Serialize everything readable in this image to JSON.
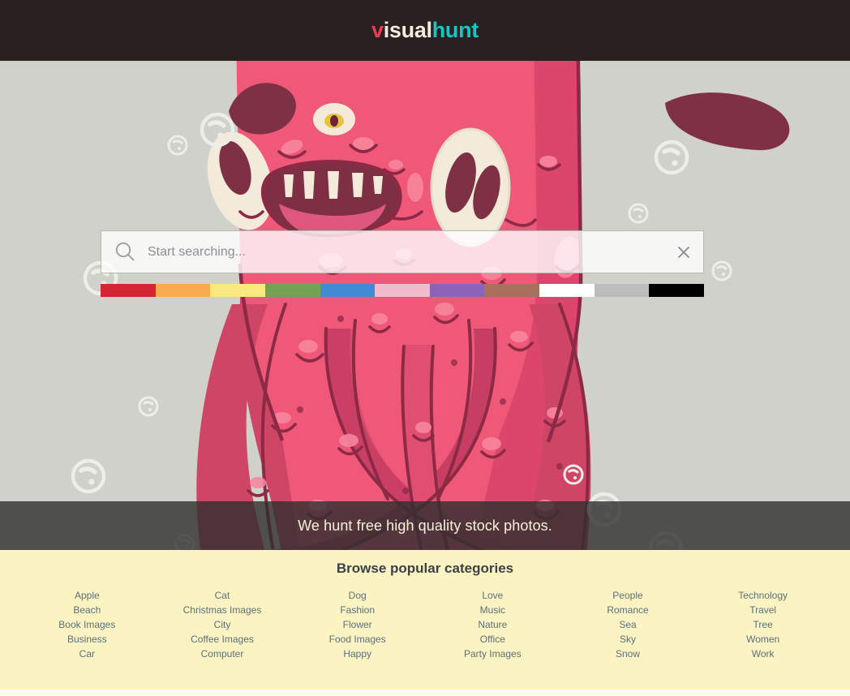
{
  "header": {
    "logo": {
      "part1": "v",
      "part2": "isual",
      "part3": "hunt"
    },
    "bg_color": "#292120",
    "logo_colors": {
      "v": "#f0385a",
      "isual": "#f3eddd",
      "hunt": "#18c4c4"
    }
  },
  "hero": {
    "bg_color": "#d0d1cb",
    "illustration": "pink-monster-illustration",
    "search": {
      "icon": "search-icon",
      "placeholder": "Start searching...",
      "value": "",
      "clear_icon": "close-icon"
    },
    "color_filters": [
      {
        "name": "red",
        "hex": "#d32534"
      },
      {
        "name": "orange",
        "hex": "#f9ac4e"
      },
      {
        "name": "yellow",
        "hex": "#f8ea7f"
      },
      {
        "name": "green",
        "hex": "#73a252"
      },
      {
        "name": "blue",
        "hex": "#428bd4"
      },
      {
        "name": "pink",
        "hex": "#f0bbcc"
      },
      {
        "name": "purple",
        "hex": "#8b63b8"
      },
      {
        "name": "brown",
        "hex": "#a9705e"
      },
      {
        "name": "white",
        "hex": "#ffffff"
      },
      {
        "name": "gray",
        "hex": "#bcbcbc"
      },
      {
        "name": "black",
        "hex": "#000000"
      }
    ],
    "tagline": "We hunt free high quality stock photos.",
    "tagline_bar_color": "#2e2e2e"
  },
  "categories": {
    "bg_color": "#fbf3c2",
    "title": "Browse popular categories",
    "columns": [
      {
        "items": [
          "Apple",
          "Beach",
          "Book Images",
          "Business",
          "Car"
        ]
      },
      {
        "items": [
          "Cat",
          "Christmas Images",
          "City",
          "Coffee Images",
          "Computer"
        ]
      },
      {
        "items": [
          "Dog",
          "Fashion",
          "Flower",
          "Food Images",
          "Happy"
        ]
      },
      {
        "items": [
          "Love",
          "Music",
          "Nature",
          "Office",
          "Party Images"
        ]
      },
      {
        "items": [
          "People",
          "Romance",
          "Sea",
          "Sky",
          "Snow"
        ]
      },
      {
        "items": [
          "Technology",
          "Travel",
          "Tree",
          "Women",
          "Work"
        ]
      }
    ]
  }
}
